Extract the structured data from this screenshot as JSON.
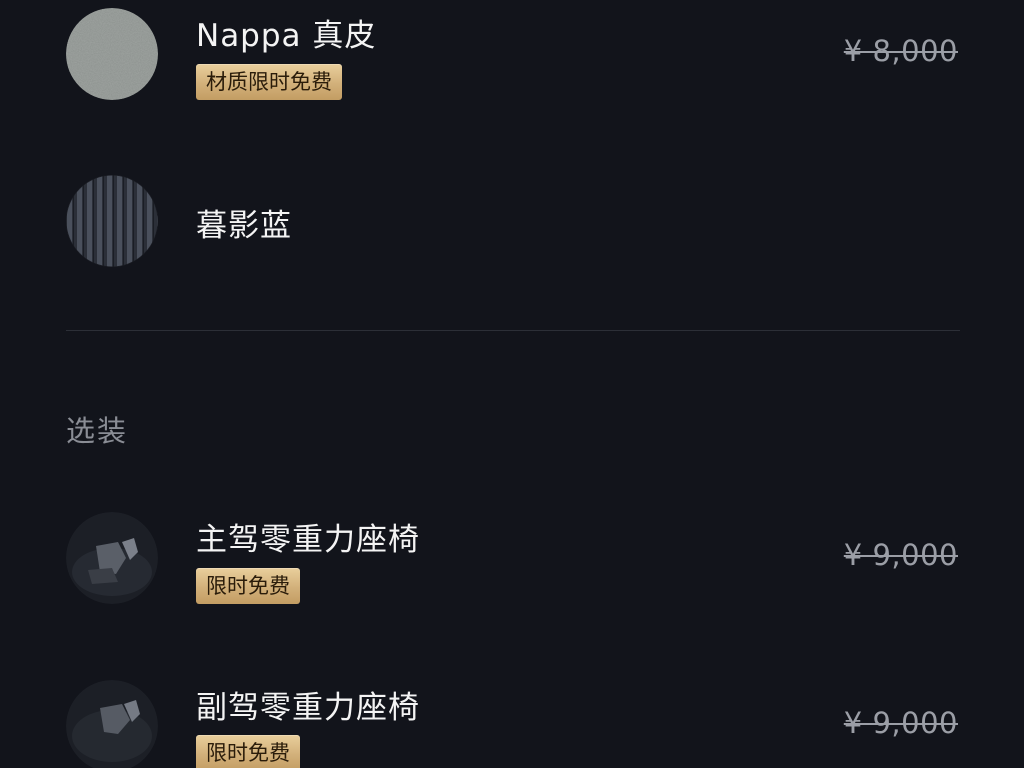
{
  "options": [
    {
      "name": "Nappa 真皮",
      "badge": "材质限时免费",
      "price": "¥ 8,000",
      "thumb_icon": "leather-texture-swatch"
    },
    {
      "name": "暮影蓝",
      "thumb_icon": "striped-fabric-swatch"
    }
  ],
  "addons": {
    "section_title": "选装",
    "items": [
      {
        "name": "主驾零重力座椅",
        "badge": "限时免费",
        "price": "¥ 9,000",
        "thumb_icon": "seat-photo"
      },
      {
        "name": "副驾零重力座椅",
        "badge": "限时免费",
        "price": "¥ 9,000",
        "thumb_icon": "seat-photo"
      }
    ]
  },
  "colors": {
    "background": "#12141b",
    "badge_gold": "#d2b07a",
    "price_gray": "#9b9ea6",
    "section_gray": "#8a8d95"
  }
}
